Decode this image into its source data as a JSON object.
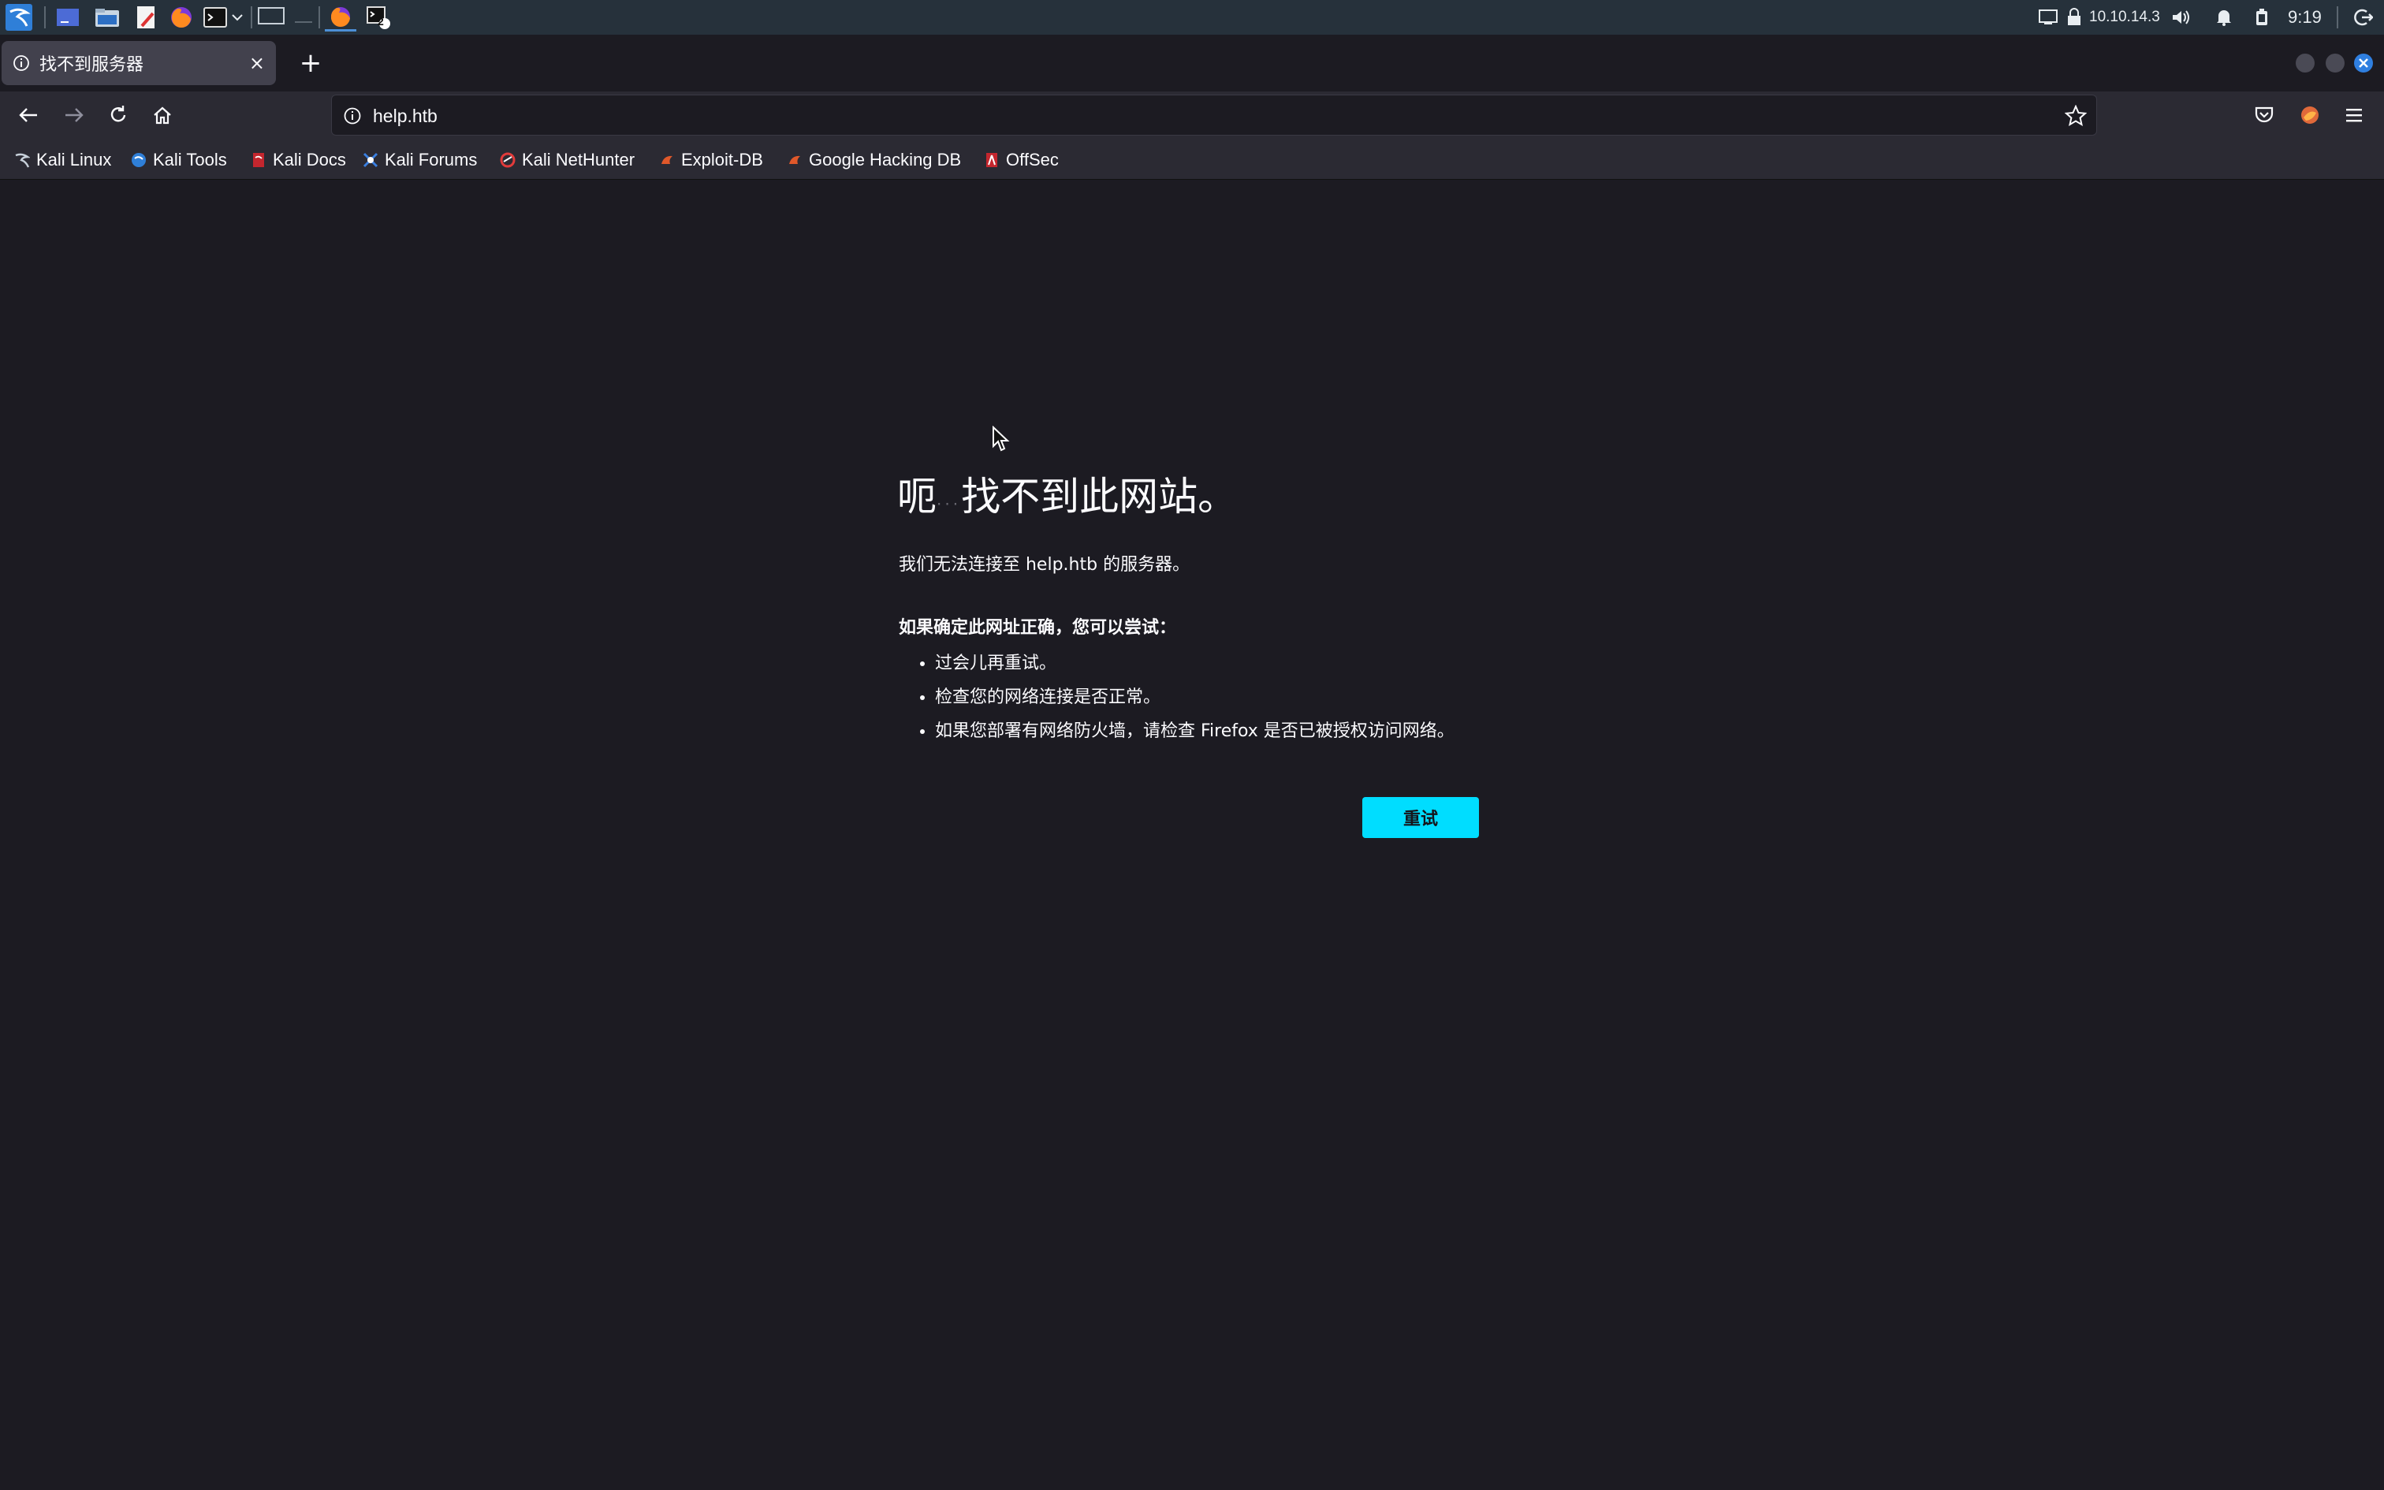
{
  "panel": {
    "ip_address": "10.10.14.3",
    "clock": "9:19",
    "workspace_badge": "2"
  },
  "browser": {
    "tab": {
      "title": "找不到服务器",
      "close_glyph": "×"
    },
    "new_tab_glyph": "+",
    "url": "help.htb",
    "bookmarks": [
      {
        "label": "Kali Linux",
        "icon": "kali-dragon-icon"
      },
      {
        "label": "Kali Tools",
        "icon": "kali-tools-icon"
      },
      {
        "label": "Kali Docs",
        "icon": "kali-docs-icon"
      },
      {
        "label": "Kali Forums",
        "icon": "kali-forums-icon"
      },
      {
        "label": "Kali NetHunter",
        "icon": "nethunter-icon"
      },
      {
        "label": "Exploit-DB",
        "icon": "exploit-db-icon"
      },
      {
        "label": "Google Hacking DB",
        "icon": "ghdb-icon"
      },
      {
        "label": "OffSec",
        "icon": "offsec-icon"
      }
    ]
  },
  "error_page": {
    "title_start": "呃",
    "title_dots": "...",
    "title_end": "找不到此网站。",
    "description": "我们无法连接至 help.htb 的服务器。",
    "suggestion_heading": "如果确定此网址正确，您可以尝试：",
    "suggestions": [
      "过会儿再重试。",
      "检查您的网络连接是否正常。",
      "如果您部署有网络防火墙，请检查 Firefox 是否已被授权访问网络。"
    ],
    "retry_label": "重试"
  },
  "colors": {
    "panel_bg": "#26313b",
    "chrome_bg": "#2b2a33",
    "page_bg": "#1c1b22",
    "accent": "#00ddff"
  }
}
